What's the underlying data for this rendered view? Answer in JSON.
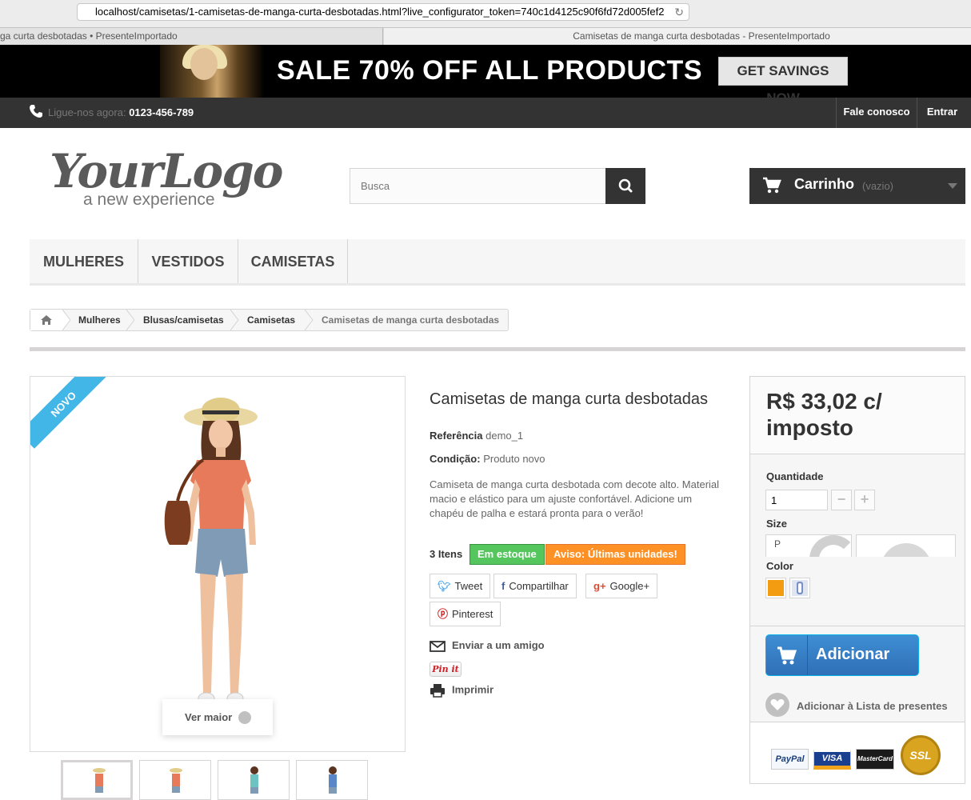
{
  "browser": {
    "url": "localhost/camisetas/1-camisetas-de-manga-curta-desbotadas.html?live_configurator_token=740c1d4125c90f6fd72d005fef2",
    "tab_left": "ga curta desbotadas • PresenteImportado",
    "tab_right": "Camisetas de manga curta desbotadas - PresenteImportado"
  },
  "banner": {
    "headline": "SALE 70% OFF ALL PRODUCTS",
    "cta": "GET SAVINGS NOW"
  },
  "topnav": {
    "call_label": "Ligue-nos agora:",
    "phone": "0123-456-789",
    "contact": "Fale conosco",
    "login": "Entrar"
  },
  "header": {
    "logo_text": "YourLogo",
    "logo_sub": "a new experience",
    "search_placeholder": "Busca",
    "cart_label": "Carrinho",
    "cart_status": "(vazio)"
  },
  "menu": [
    "MULHERES",
    "VESTIDOS",
    "CAMISETAS"
  ],
  "breadcrumb": [
    "Mulheres",
    "Blusas/camisetas",
    "Camisetas",
    "Camisetas de manga curta desbotadas"
  ],
  "product": {
    "badge": "NOVO",
    "zoom": "Ver maior",
    "title": "Camisetas de manga curta desbotadas",
    "ref_label": "Referência",
    "ref_value": "demo_1",
    "cond_label": "Condição:",
    "cond_value": "Produto novo",
    "description": "Camiseta de manga curta desbotada com decote alto. Material macio e elástico para um ajuste confortável. Adicione um chapéu de palha e estará pronta para o verão!",
    "items": "3 Itens",
    "stock": "Em estoque",
    "warning": "Aviso: Últimas unidades!",
    "share": {
      "tweet": "Tweet",
      "share": "Compartilhar",
      "google": "Google+",
      "pinterest": "Pinterest"
    },
    "send_friend": "Enviar a um amigo",
    "pinit": "Pin it",
    "print": "Imprimir"
  },
  "buy": {
    "price": "R$ 33,02 c/ imposto",
    "qty_label": "Quantidade",
    "qty_value": "1",
    "qty_minus": "−",
    "qty_plus": "+",
    "size_label": "Size",
    "size_value": "P",
    "color_label": "Color",
    "color_swatch": "#f39c11",
    "add": "Adicionar",
    "wishlist": "Adicionar à Lista de presentes",
    "payments": [
      "PayPal",
      "VISA",
      "MasterCard",
      "SSL"
    ]
  },
  "colors": {
    "accent_blue": "#2f6fb7",
    "stock_green": "#55c65e",
    "warning_orange": "#fe9126",
    "ribbon_blue": "#42b6e6"
  }
}
